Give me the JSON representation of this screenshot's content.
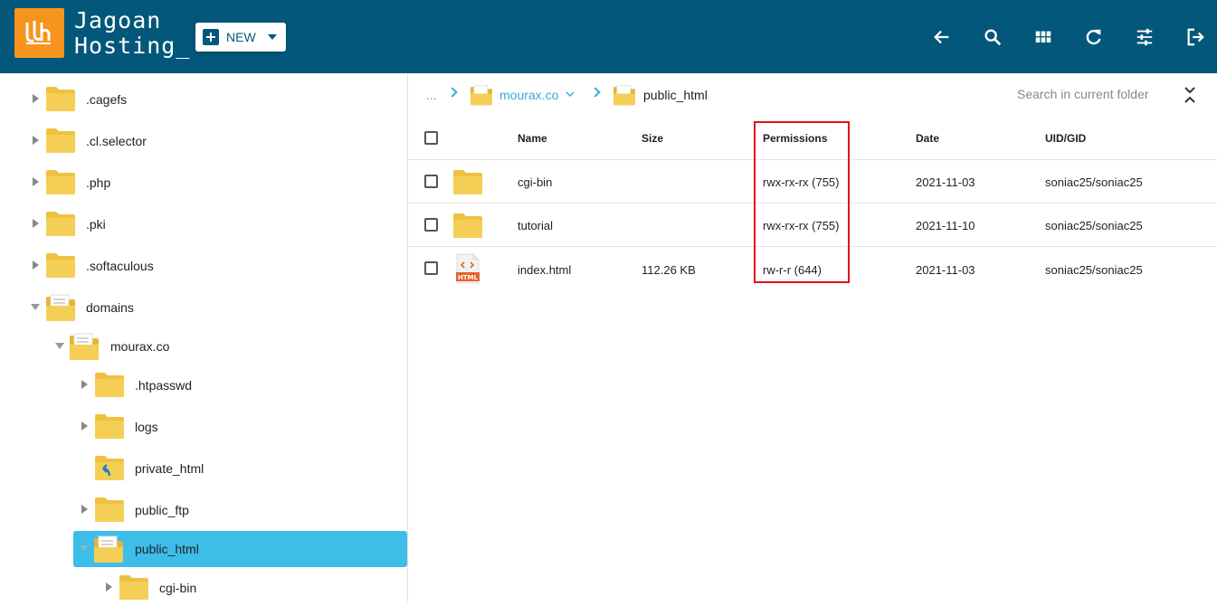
{
  "header": {
    "brand_line1": "Jagoan",
    "brand_line2": "Hosting_",
    "new_label": "NEW",
    "icons": [
      "back-arrow-icon",
      "search-icon",
      "grid-view-icon",
      "refresh-icon",
      "settings-sliders-icon",
      "logout-icon"
    ],
    "bg_color": "#02577a",
    "logo_color": "#f7941d"
  },
  "sidebar": {
    "items": [
      {
        "label": ".cagefs"
      },
      {
        "label": ".cl.selector"
      },
      {
        "label": ".php"
      },
      {
        "label": ".pki"
      },
      {
        "label": ".softaculous"
      },
      {
        "label": "domains"
      },
      {
        "label": "mourax.co"
      },
      {
        "label": ".htpasswd"
      },
      {
        "label": "logs"
      },
      {
        "label": "private_html"
      },
      {
        "label": "public_ftp"
      },
      {
        "label": "public_html"
      },
      {
        "label": "cgi-bin"
      }
    ],
    "selected_color": "#3ebde9"
  },
  "breadcrumb": {
    "dots": "...",
    "domain": "mourax.co",
    "current": "public_html"
  },
  "search": {
    "placeholder": "Search in current folder"
  },
  "table": {
    "headers": {
      "name": "Name",
      "size": "Size",
      "permissions": "Permissions",
      "date": "Date",
      "uid": "UID/GID"
    },
    "rows": [
      {
        "name": "cgi-bin",
        "size": "",
        "permissions": "rwx-rx-rx (755)",
        "date": "2021-11-03",
        "uid": "soniac25/soniac25",
        "type": "folder"
      },
      {
        "name": "tutorial",
        "size": "",
        "permissions": "rwx-rx-rx (755)",
        "date": "2021-11-10",
        "uid": "soniac25/soniac25",
        "type": "folder"
      },
      {
        "name": "index.html",
        "size": "112.26 KB",
        "permissions": "rw-r-r (644)",
        "date": "2021-11-03",
        "uid": "soniac25/soniac25",
        "type": "html"
      }
    ],
    "html_badge": "HTML"
  },
  "highlight_color": "#e0121c"
}
